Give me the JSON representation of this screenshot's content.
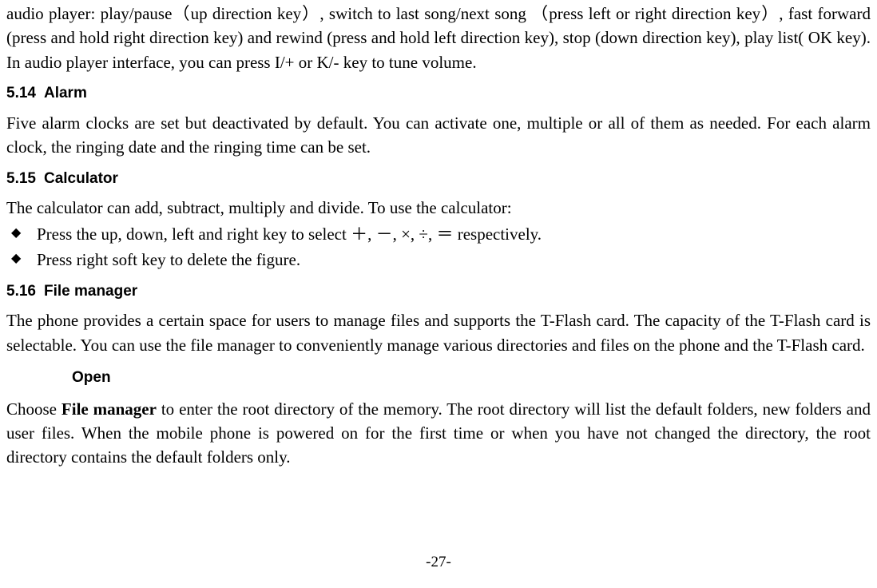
{
  "intro_paragraph": "audio player: play/pause（up direction key）, switch to last song/next song （press left or right direction key）, fast forward (press and hold right direction key) and rewind (press and hold left direction key), stop (down direction key), play list( OK key). In audio player interface, you can press I/+ or K/- key to tune volume.",
  "sections": {
    "alarm": {
      "num": "5.14",
      "title": "Alarm",
      "body": "Five alarm clocks are set but deactivated by default. You can activate one, multiple or all of them as needed. For each alarm clock, the ringing date and the ringing time can be set."
    },
    "calculator": {
      "num": "5.15",
      "title": "Calculator",
      "intro": "The calculator can add, subtract, multiply and divide. To use the calculator:",
      "bullets": [
        "Press the up, down, left and right key to select  ＋,  －, ×, ÷,  ＝  respectively.",
        "Press right soft key to delete the figure."
      ]
    },
    "file_manager": {
      "num": "5.16",
      "title": "File manager",
      "body": "The phone provides a certain space for users to manage files and supports the T-Flash card. The capacity of the T-Flash card is selectable. You can use the file manager to conveniently manage various directories and files on the phone and the T-Flash card.",
      "sub": {
        "title": "Open",
        "body_prefix": "Choose ",
        "body_bold": "File manager",
        "body_suffix": " to enter the root directory of the memory. The root directory will list the default folders, new folders and user files. When the mobile phone is powered on for the first time or when you have not changed the directory, the root directory contains the default folders only."
      }
    }
  },
  "page_number": "-27-"
}
